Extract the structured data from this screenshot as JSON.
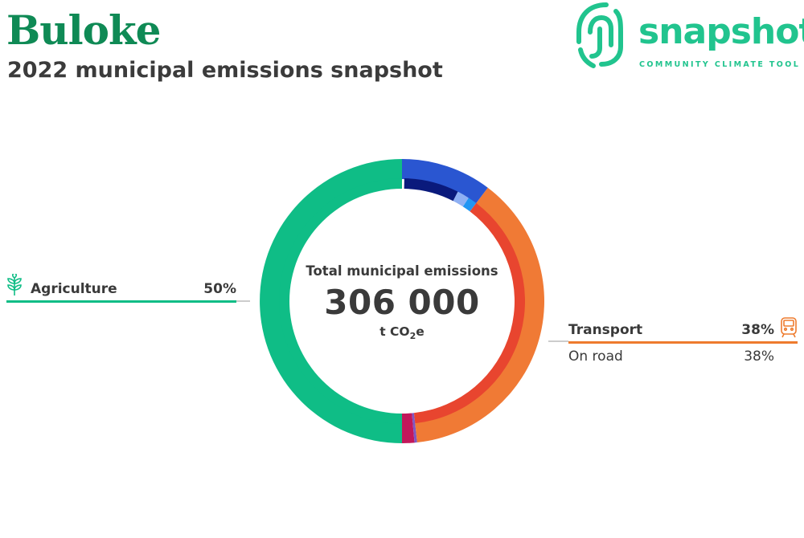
{
  "header": {
    "title": "Buloke",
    "subtitle": "2022 municipal emissions snapshot"
  },
  "logo": {
    "word": "snapshot",
    "tagline": "COMMUNITY CLIMATE TOOL"
  },
  "center": {
    "label": "Total municipal emissions",
    "total": "306 000",
    "unit_prefix": "t CO",
    "unit_sub": "2",
    "unit_suffix": "e"
  },
  "callouts": {
    "agriculture": {
      "name": "Agriculture",
      "pct": "50%",
      "icon": "sprout-icon",
      "color": "#0fbd86"
    },
    "transport": {
      "name": "Transport",
      "pct": "38%",
      "icon": "train-icon",
      "color": "#ee7b2e"
    },
    "on_road": {
      "name": "On road",
      "pct": "38%"
    }
  },
  "chart_data": {
    "type": "pie",
    "total_value": 306000,
    "unit": "t CO2e",
    "outer_ring": [
      {
        "name": "Agriculture",
        "percent": 50,
        "color": "#0fbd86"
      },
      {
        "percent": 1.4,
        "color": "#c2185b"
      },
      {
        "percent": 0.3,
        "color": "#7e57c2"
      },
      {
        "name": "Transport",
        "percent": 38,
        "color": "#f07a35"
      },
      {
        "percent": 10.3,
        "color": "#2a56d1"
      }
    ],
    "inner_ring": [
      {
        "percent": 50,
        "color": "#0fbd86"
      },
      {
        "percent": 1.4,
        "color": "#c2185b"
      },
      {
        "percent": 0.3,
        "color": "#7e57c2"
      },
      {
        "name": "On road",
        "percent": 38,
        "color": "#e8452f"
      },
      {
        "percent": 1.2,
        "color": "#2196f3"
      },
      {
        "percent": 1.6,
        "color": "#8fb0f3"
      },
      {
        "percent": 7.2,
        "color": "#0a1a7c"
      }
    ]
  }
}
